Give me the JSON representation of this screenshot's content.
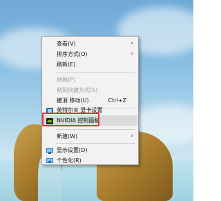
{
  "menu": {
    "items": [
      {
        "label": "查看(V)"
      },
      {
        "label": "排序方式(O)"
      },
      {
        "label": "刷新(E)"
      },
      {
        "label": "粘贴(P)"
      },
      {
        "label": "粘贴快捷方式(S)"
      },
      {
        "label": "撤消 移动(U)",
        "shortcut": "Ctrl+Z"
      },
      {
        "label": "英特尔® 显卡设置",
        "icon": "intel-graphics-icon"
      },
      {
        "label": "NVIDIA 控制面板",
        "icon": "nvidia-icon"
      },
      {
        "label": "新建(W)"
      },
      {
        "label": "显示设置(D)",
        "icon": "display-icon"
      },
      {
        "label": "个性化(R)",
        "icon": "personalize-icon"
      }
    ],
    "highlight_color": "#e0342f",
    "arrow": "›"
  },
  "colors": {
    "nvidia": "#76b900",
    "intel": "#1f6fb8"
  }
}
